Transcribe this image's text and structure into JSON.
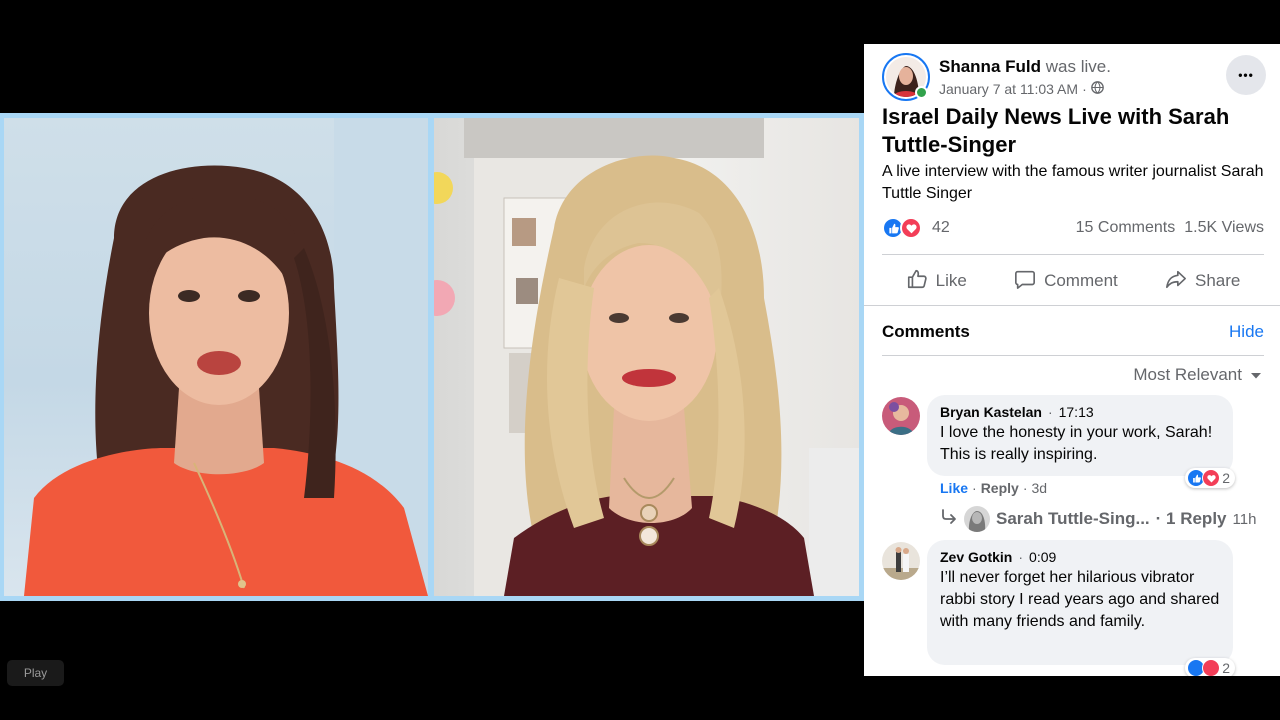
{
  "video": {
    "play_label": "Play",
    "participants": [
      {
        "name": "left-participant"
      },
      {
        "name": "right-participant"
      }
    ]
  },
  "post": {
    "author": "Shanna Fuld",
    "author_suffix": "was live.",
    "date": "January 7 at 11:03 AM",
    "date_separator": "·",
    "privacy_icon": "globe-icon",
    "more_label": "•••",
    "title": "Israel Daily News Live with Sarah Tuttle-Singer",
    "description": "A live interview with the famous writer journalist Sarah Tuttle Singer",
    "reactions_count": "42",
    "comments_count": "15 Comments",
    "views_count": "1.5K Views",
    "actions": {
      "like": "Like",
      "comment": "Comment",
      "share": "Share"
    }
  },
  "comments_section": {
    "heading": "Comments",
    "hide_label": "Hide",
    "sort_label": "Most Relevant",
    "items": [
      {
        "name": "Bryan Kastelan",
        "dot": "·",
        "time": "17:13",
        "text": "I love the honesty in your work, Sarah! This is really inspiring.",
        "reaction_count": "2",
        "like": "Like",
        "sep": "·",
        "reply": "Reply",
        "age": "3d",
        "reply_author": "Sarah Tuttle-Sing...",
        "reply_summary": "· 1 Reply",
        "reply_age": "11h"
      },
      {
        "name": "Zev Gotkin",
        "dot": "·",
        "time": "0:09",
        "text": "I’ll never forget her hilarious vibrator rabbi story I read years ago and shared with many friends and family.",
        "reaction_count": "2"
      }
    ]
  },
  "colors": {
    "facebook_blue": "#1877f2",
    "love_red": "#f33e58",
    "video_border": "#a9d7f5",
    "online_green": "#31a24c"
  }
}
